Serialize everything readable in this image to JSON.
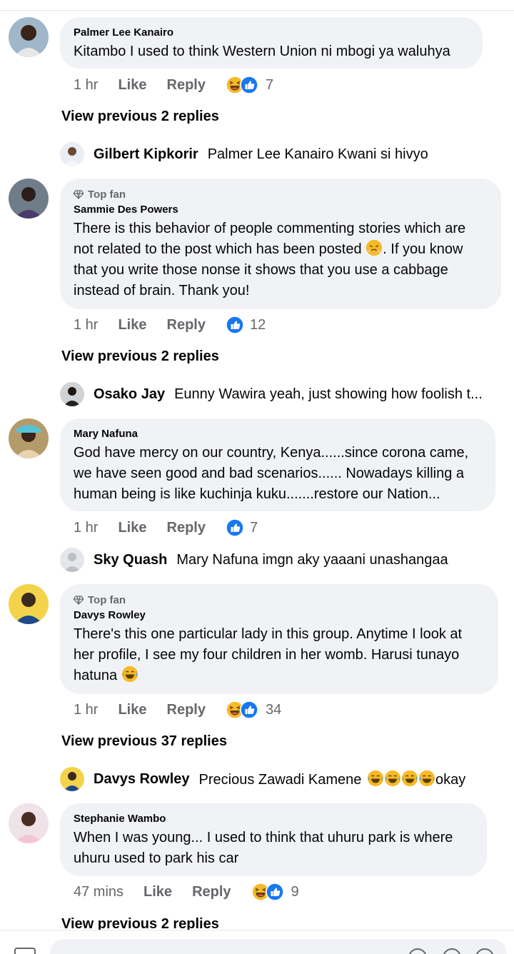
{
  "comments": [
    {
      "author": "Palmer Lee Kanairo",
      "top_fan": "",
      "text": "Kitambo I used to think Western Union ni mbogi ya waluhya",
      "time": "1 hr",
      "like": "Like",
      "reply": "Reply",
      "reaction_count": "7",
      "reactions": [
        "laugh-emoji-icon",
        "like-emoji-icon"
      ],
      "view_previous": "View previous 2 replies",
      "reply_preview": {
        "author": "Gilbert Kipkorir",
        "text": "Palmer Lee Kanairo Kwani si hivyo"
      }
    },
    {
      "author": "Sammie Des Powers",
      "top_fan": "Top fan",
      "text_parts": [
        "There is this behavior of people commenting stories which are not related to the post which has been posted ",
        ". If you know that you write those nonse it shows that you use a cabbage instead of brain. Thank you!"
      ],
      "time": "1 hr",
      "like": "Like",
      "reply": "Reply",
      "reaction_count": "12",
      "reactions": [
        "like-emoji-icon"
      ],
      "view_previous": "View previous 2 replies",
      "reply_preview": {
        "author": "Osako Jay",
        "text": "Eunny Wawira yeah, just showing how foolish t..."
      }
    },
    {
      "author": "Mary Nafuna",
      "top_fan": "",
      "text": "God have mercy on our country, Kenya......since corona came, we have seen good and bad scenarios...... Nowadays killing a human being is like kuchinja kuku.......restore our Nation...",
      "time": "1 hr",
      "like": "Like",
      "reply": "Reply",
      "reaction_count": "7",
      "reactions": [
        "like-emoji-icon"
      ],
      "reply_preview": {
        "author": "Sky Quash",
        "text": "Mary Nafuna imgn aky yaaani unashangaa"
      }
    },
    {
      "author": "Davys Rowley",
      "top_fan": "Top fan",
      "text": "There's this one particular lady in this group. Anytime I look at her profile, I see my four children in her womb. Harusi tunayo hatuna ",
      "time": "1 hr",
      "like": "Like",
      "reply": "Reply",
      "reaction_count": "34",
      "reactions": [
        "laugh-emoji-icon",
        "like-emoji-icon"
      ],
      "view_previous": "View previous 37 replies",
      "reply_preview": {
        "author": "Davys Rowley",
        "text": "Precious Zawadi Kamene",
        "suffix": "okay"
      }
    },
    {
      "author": "Stephanie Wambo",
      "top_fan": "",
      "text": "When I was young... I used to think that uhuru park is where uhuru used to park his car",
      "time": "47 mins",
      "like": "Like",
      "reply": "Reply",
      "reaction_count": "9",
      "reactions": [
        "laugh-emoji-icon",
        "like-emoji-icon"
      ],
      "view_previous": "View previous 2 replies"
    }
  ],
  "colors": {
    "like_blue": "#1877f2",
    "bubble_bg": "#f0f2f5",
    "meta_gray": "#65676b",
    "emoji_yellow": "#f7b928"
  }
}
